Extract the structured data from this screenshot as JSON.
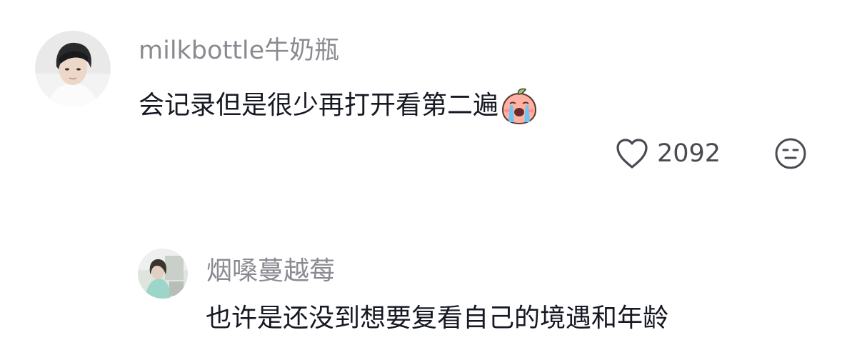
{
  "comments": [
    {
      "username": "milkbottle牛奶瓶",
      "text": "会记录但是很少再打开看第二遍",
      "emoji": "crying-peach-emoji",
      "likes": "2092",
      "like_icon": "heart-outline-icon",
      "dislike_icon": "meh-face-icon"
    },
    {
      "username": "烟嗓蔓越莓",
      "text": "也许是还没到想要复看自己的境遇和年龄"
    }
  ],
  "colors": {
    "username": "#8a8b91",
    "text": "#161823",
    "icon": "#4a4b52"
  }
}
